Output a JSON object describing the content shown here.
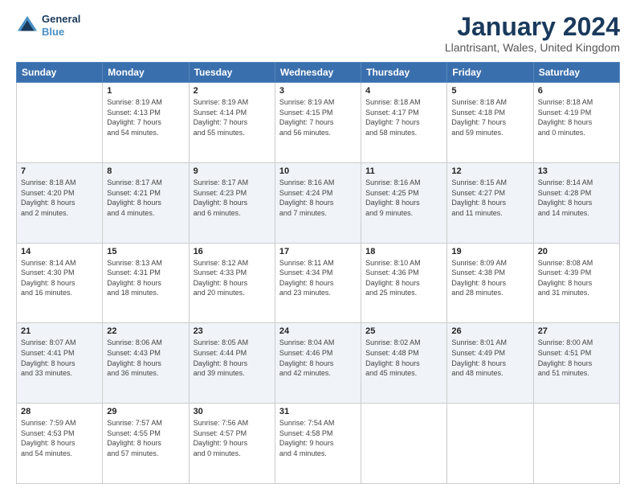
{
  "header": {
    "logo_line1": "General",
    "logo_line2": "Blue",
    "title": "January 2024",
    "subtitle": "Llantrisant, Wales, United Kingdom"
  },
  "calendar": {
    "days_of_week": [
      "Sunday",
      "Monday",
      "Tuesday",
      "Wednesday",
      "Thursday",
      "Friday",
      "Saturday"
    ],
    "weeks": [
      [
        {
          "num": "",
          "detail": ""
        },
        {
          "num": "1",
          "detail": "Sunrise: 8:19 AM\nSunset: 4:13 PM\nDaylight: 7 hours\nand 54 minutes."
        },
        {
          "num": "2",
          "detail": "Sunrise: 8:19 AM\nSunset: 4:14 PM\nDaylight: 7 hours\nand 55 minutes."
        },
        {
          "num": "3",
          "detail": "Sunrise: 8:19 AM\nSunset: 4:15 PM\nDaylight: 7 hours\nand 56 minutes."
        },
        {
          "num": "4",
          "detail": "Sunrise: 8:18 AM\nSunset: 4:17 PM\nDaylight: 7 hours\nand 58 minutes."
        },
        {
          "num": "5",
          "detail": "Sunrise: 8:18 AM\nSunset: 4:18 PM\nDaylight: 7 hours\nand 59 minutes."
        },
        {
          "num": "6",
          "detail": "Sunrise: 8:18 AM\nSunset: 4:19 PM\nDaylight: 8 hours\nand 0 minutes."
        }
      ],
      [
        {
          "num": "7",
          "detail": "Sunrise: 8:18 AM\nSunset: 4:20 PM\nDaylight: 8 hours\nand 2 minutes."
        },
        {
          "num": "8",
          "detail": "Sunrise: 8:17 AM\nSunset: 4:21 PM\nDaylight: 8 hours\nand 4 minutes."
        },
        {
          "num": "9",
          "detail": "Sunrise: 8:17 AM\nSunset: 4:23 PM\nDaylight: 8 hours\nand 6 minutes."
        },
        {
          "num": "10",
          "detail": "Sunrise: 8:16 AM\nSunset: 4:24 PM\nDaylight: 8 hours\nand 7 minutes."
        },
        {
          "num": "11",
          "detail": "Sunrise: 8:16 AM\nSunset: 4:25 PM\nDaylight: 8 hours\nand 9 minutes."
        },
        {
          "num": "12",
          "detail": "Sunrise: 8:15 AM\nSunset: 4:27 PM\nDaylight: 8 hours\nand 11 minutes."
        },
        {
          "num": "13",
          "detail": "Sunrise: 8:14 AM\nSunset: 4:28 PM\nDaylight: 8 hours\nand 14 minutes."
        }
      ],
      [
        {
          "num": "14",
          "detail": "Sunrise: 8:14 AM\nSunset: 4:30 PM\nDaylight: 8 hours\nand 16 minutes."
        },
        {
          "num": "15",
          "detail": "Sunrise: 8:13 AM\nSunset: 4:31 PM\nDaylight: 8 hours\nand 18 minutes."
        },
        {
          "num": "16",
          "detail": "Sunrise: 8:12 AM\nSunset: 4:33 PM\nDaylight: 8 hours\nand 20 minutes."
        },
        {
          "num": "17",
          "detail": "Sunrise: 8:11 AM\nSunset: 4:34 PM\nDaylight: 8 hours\nand 23 minutes."
        },
        {
          "num": "18",
          "detail": "Sunrise: 8:10 AM\nSunset: 4:36 PM\nDaylight: 8 hours\nand 25 minutes."
        },
        {
          "num": "19",
          "detail": "Sunrise: 8:09 AM\nSunset: 4:38 PM\nDaylight: 8 hours\nand 28 minutes."
        },
        {
          "num": "20",
          "detail": "Sunrise: 8:08 AM\nSunset: 4:39 PM\nDaylight: 8 hours\nand 31 minutes."
        }
      ],
      [
        {
          "num": "21",
          "detail": "Sunrise: 8:07 AM\nSunset: 4:41 PM\nDaylight: 8 hours\nand 33 minutes."
        },
        {
          "num": "22",
          "detail": "Sunrise: 8:06 AM\nSunset: 4:43 PM\nDaylight: 8 hours\nand 36 minutes."
        },
        {
          "num": "23",
          "detail": "Sunrise: 8:05 AM\nSunset: 4:44 PM\nDaylight: 8 hours\nand 39 minutes."
        },
        {
          "num": "24",
          "detail": "Sunrise: 8:04 AM\nSunset: 4:46 PM\nDaylight: 8 hours\nand 42 minutes."
        },
        {
          "num": "25",
          "detail": "Sunrise: 8:02 AM\nSunset: 4:48 PM\nDaylight: 8 hours\nand 45 minutes."
        },
        {
          "num": "26",
          "detail": "Sunrise: 8:01 AM\nSunset: 4:49 PM\nDaylight: 8 hours\nand 48 minutes."
        },
        {
          "num": "27",
          "detail": "Sunrise: 8:00 AM\nSunset: 4:51 PM\nDaylight: 8 hours\nand 51 minutes."
        }
      ],
      [
        {
          "num": "28",
          "detail": "Sunrise: 7:59 AM\nSunset: 4:53 PM\nDaylight: 8 hours\nand 54 minutes."
        },
        {
          "num": "29",
          "detail": "Sunrise: 7:57 AM\nSunset: 4:55 PM\nDaylight: 8 hours\nand 57 minutes."
        },
        {
          "num": "30",
          "detail": "Sunrise: 7:56 AM\nSunset: 4:57 PM\nDaylight: 9 hours\nand 0 minutes."
        },
        {
          "num": "31",
          "detail": "Sunrise: 7:54 AM\nSunset: 4:58 PM\nDaylight: 9 hours\nand 4 minutes."
        },
        {
          "num": "",
          "detail": ""
        },
        {
          "num": "",
          "detail": ""
        },
        {
          "num": "",
          "detail": ""
        }
      ]
    ]
  }
}
